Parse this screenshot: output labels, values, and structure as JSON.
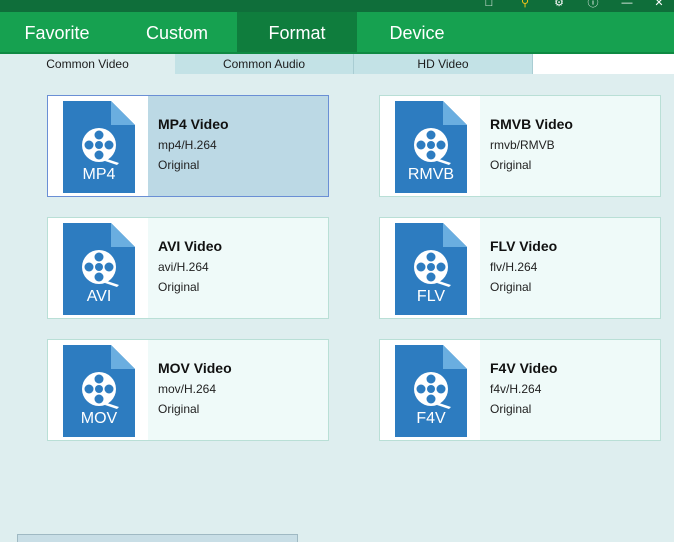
{
  "nav": {
    "tabs": [
      {
        "label": "Favorite"
      },
      {
        "label": "Custom"
      },
      {
        "label": "Format"
      },
      {
        "label": "Device"
      }
    ],
    "active_tab": "Format"
  },
  "subtabs": {
    "items": [
      {
        "label": "Common Video"
      },
      {
        "label": "Common Audio"
      },
      {
        "label": "HD Video"
      }
    ],
    "active": "Common Video"
  },
  "formats": [
    {
      "badge": "MP4",
      "title": "MP4 Video",
      "codec": "mp4/H.264",
      "quality": "Original",
      "selected": true
    },
    {
      "badge": "RMVB",
      "title": "RMVB Video",
      "codec": "rmvb/RMVB",
      "quality": "Original",
      "selected": false
    },
    {
      "badge": "AVI",
      "title": "AVI Video",
      "codec": "avi/H.264",
      "quality": "Original",
      "selected": false
    },
    {
      "badge": "FLV",
      "title": "FLV Video",
      "codec": "flv/H.264",
      "quality": "Original",
      "selected": false
    },
    {
      "badge": "MOV",
      "title": "MOV Video",
      "codec": "mov/H.264",
      "quality": "Original",
      "selected": false
    },
    {
      "badge": "F4V",
      "title": "F4V Video",
      "codec": "f4v/H.264",
      "quality": "Original",
      "selected": false
    }
  ],
  "colors": {
    "nav_bg": "#16a150",
    "nav_active": "#0f7d3d",
    "icon_blue": "#2d7cc0",
    "icon_fold": "#6aaee0",
    "selected_card": "#bcd9e5"
  },
  "titlebar_icons": [
    "feedback-icon",
    "key-icon",
    "gear-icon",
    "info-icon",
    "minimize-icon",
    "close-icon"
  ]
}
